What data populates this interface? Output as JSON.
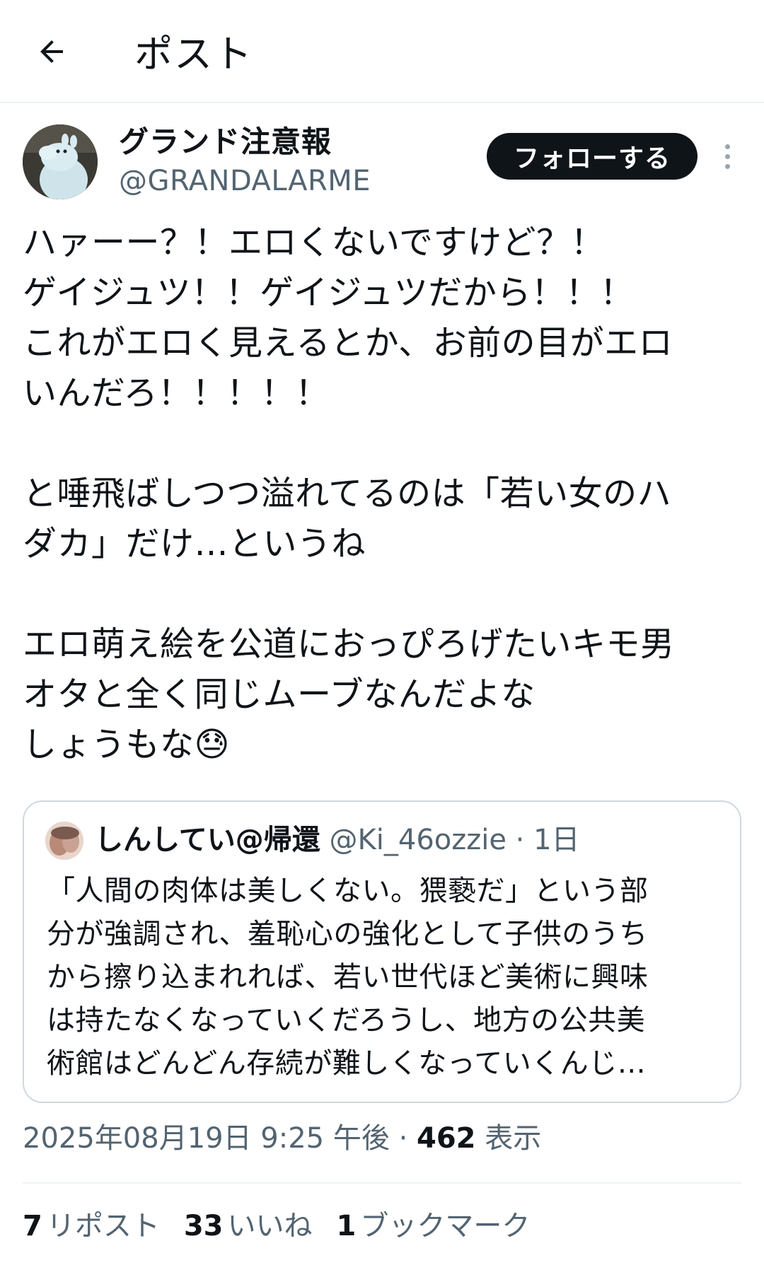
{
  "header": {
    "back_icon": "arrow-left-icon",
    "title": "ポスト"
  },
  "author": {
    "display_name": "グランド注意報",
    "handle": "@GRANDALARME",
    "follow_label": "フォローする",
    "more_icon": "more-vertical-icon"
  },
  "post": {
    "text": "ハァーー？！エロくないですけど？！\nゲイジュツ！！ゲイジュツだから！！！\nこれがエロく見えるとか、お前の目がエロ\nいんだろ！！！！！\n\nと唾飛ばしつつ溢れてるのは「若い女のハ\nダカ」だけ…というね\n\nエロ萌え絵を公道におっぴろげたいキモ男\nオタと全く同じムーブなんだよな\nしょうもな😓"
  },
  "quote": {
    "display_name": "しんしてい@帰還",
    "meta": " @Ki_46ozzie · 1日",
    "text": "「人間の肉体は美しくない。猥褻だ」という部\n分が強調され、羞恥心の強化として子供のうち\nから擦り込まれれば、若い世代ほど美術に興味\nは持たなくなっていくだろうし、地方の公共美\n術館はどんどん存続が難しくなっていくんじ…"
  },
  "timestamp": {
    "datetime": "2025年08月19日 9:25 午後",
    "separator": " · ",
    "views_count": "462",
    "views_label": " 表示"
  },
  "stats": {
    "reposts_count": "7",
    "reposts_label": "リポスト",
    "likes_count": "33",
    "likes_label": "いいね",
    "bookmarks_count": "1",
    "bookmarks_label": "ブックマーク"
  },
  "colors": {
    "text_primary": "#0f1419",
    "text_secondary": "#536471",
    "border": "#cfd9de",
    "divider": "#eff3f4",
    "follow_bg": "#0f1419"
  }
}
